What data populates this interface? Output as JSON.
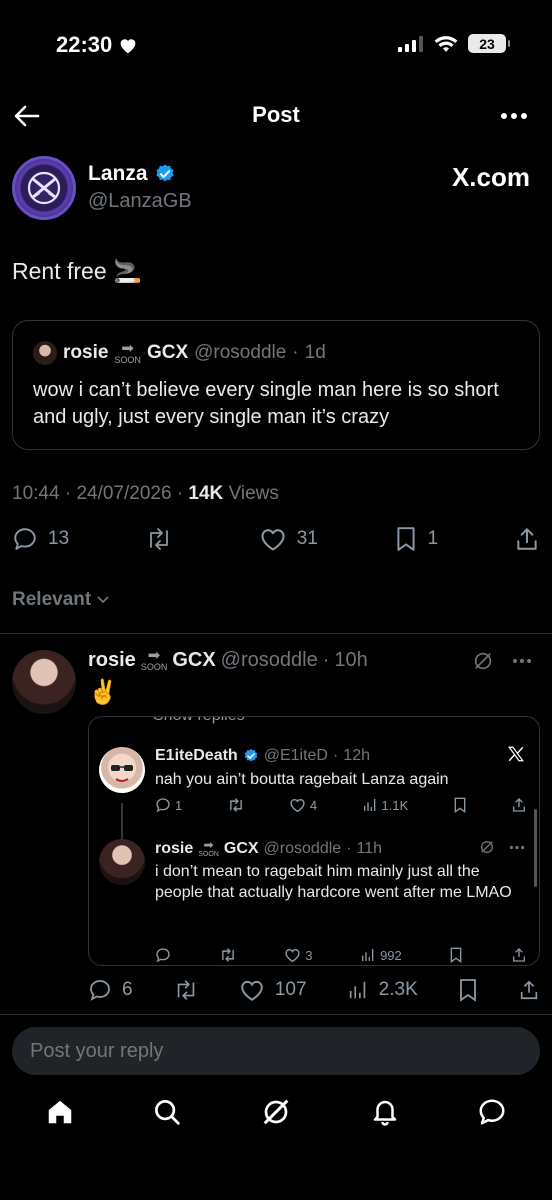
{
  "status_bar": {
    "time": "22:30",
    "battery": "23"
  },
  "header": {
    "title": "Post"
  },
  "author": {
    "name": "Lanza",
    "handle": "@LanzaGB",
    "source_label": "X.com"
  },
  "post": {
    "text": "Rent free 🚬",
    "time": "10:44",
    "date": "24/07/2026",
    "views_count": "14K",
    "views_label": "Views",
    "replies": "13",
    "reposts": "",
    "likes": "31",
    "bookmarks": "1"
  },
  "quote": {
    "name_left": "rosie",
    "soon": "SOON",
    "name_right": "GCX",
    "handle": "@rosoddle",
    "age": "1d",
    "text": "wow i can’t believe every single man here is so short and ugly, just every single man it’s crazy"
  },
  "sort": {
    "label": "Relevant"
  },
  "reply": {
    "name_left": "rosie",
    "soon": "SOON",
    "name_right": "GCX",
    "handle": "@rosoddle",
    "age": "10h",
    "text": "✌️",
    "replies": "6",
    "likes": "107",
    "views": "2.3K",
    "embed": {
      "show_replies": "Show replies",
      "tweets": [
        {
          "name": "E1iteDeath",
          "handle": "@E1iteD",
          "age": "12h",
          "text": "nah you ain’t boutta ragebait Lanza again",
          "replies": "1",
          "likes": "4",
          "views": "1.1K"
        },
        {
          "name_left": "rosie",
          "soon": "SOON",
          "name_right": "GCX",
          "handle": "@rosoddle",
          "age": "11h",
          "text": "i don’t mean to ragebait him mainly just all the people that actually hardcore went after me LMAO",
          "likes": "3",
          "views": "992"
        }
      ]
    }
  },
  "composer": {
    "placeholder": "Post your reply"
  },
  "colors": {
    "background": "#000000",
    "text": "#e7e9ea",
    "muted": "#71767b",
    "verified": "#1d9bf0",
    "border": "#2f3336"
  }
}
